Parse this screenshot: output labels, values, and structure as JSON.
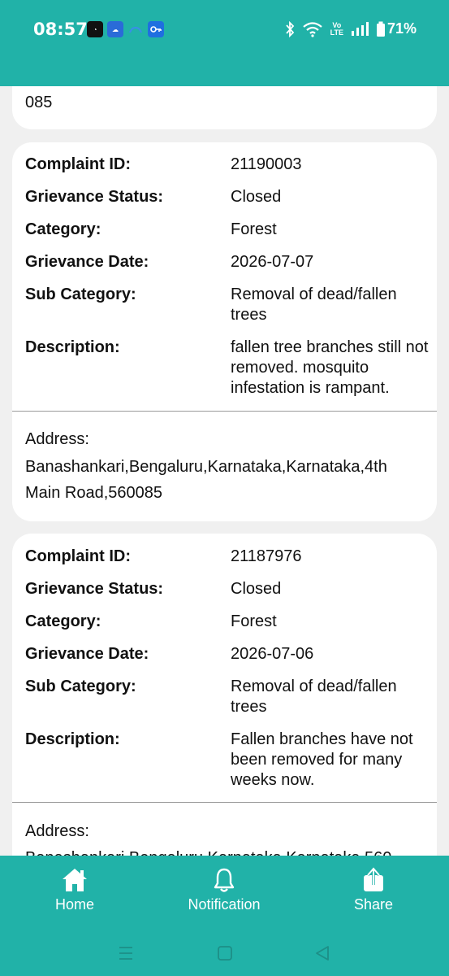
{
  "status": {
    "time": "08:57",
    "volte": [
      "Vo",
      "LTE"
    ],
    "battery": "71%"
  },
  "top_card": {
    "tail_text": "085"
  },
  "labels": {
    "complaint_id": "Complaint ID:",
    "status": "Grievance Status:",
    "category": "Category:",
    "date": "Grievance Date:",
    "sub_category": "Sub Category:",
    "description": "Description:",
    "address": "Address:"
  },
  "complaints": [
    {
      "complaint_id": "21190003",
      "status": "Closed",
      "category": "Forest",
      "date": "2026-07-07",
      "sub_category": "Removal of dead/fallen trees",
      "description": "fallen tree branches still not removed. mosquito infestation is rampant.",
      "address": "Banashankari,Bengaluru,Karnataka,Karnataka,4th Main Road,560085"
    },
    {
      "complaint_id": "21187976",
      "status": "Closed",
      "category": "Forest",
      "date": "2026-07-06",
      "sub_category": "Removal of dead/fallen trees",
      "description": "Fallen branches have not been removed for many weeks now.",
      "address": "Banashankari,Bengaluru,Karnataka,Karnataka,560"
    }
  ],
  "bottom_nav": {
    "home": "Home",
    "notification": "Notification",
    "share": "Share"
  },
  "colors": {
    "accent": "#21b2a8"
  }
}
